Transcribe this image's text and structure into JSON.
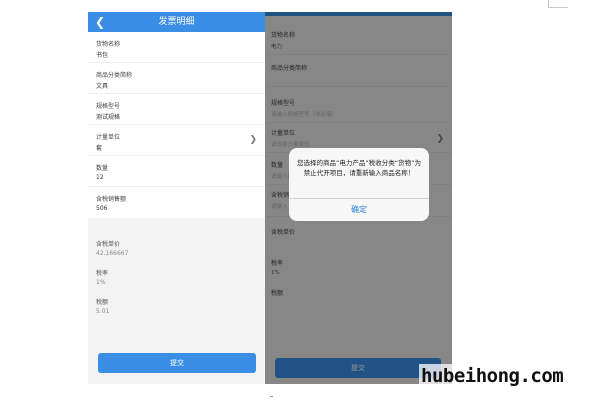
{
  "left_screen": {
    "title": "发票明细",
    "back_icon": "back-chevron-icon",
    "fields": [
      {
        "label": "货物名称",
        "value": "书包"
      },
      {
        "label": "商品分类简称",
        "value": "文具"
      },
      {
        "label": "规格型号",
        "value": "测试规格"
      },
      {
        "label": "计量单位",
        "value": "套"
      },
      {
        "label": "数量",
        "value": "12"
      },
      {
        "label": "含税销售额",
        "value": "506"
      }
    ],
    "readonly_fields": [
      {
        "label": "含税单价",
        "value": "42.166667"
      },
      {
        "label": "税率",
        "value": "1%"
      },
      {
        "label": "税额",
        "value": "5.01"
      }
    ],
    "submit_label": "提交"
  },
  "right_screen": {
    "goods_name_label": "货物名称",
    "goods_name_value": "电力",
    "category_label": "商品分类简称",
    "spec_label": "规格型号",
    "spec_placeholder": "请输入规格型号（非必填）",
    "unit_label": "计量单位",
    "unit_placeholder": "请选择计量单位",
    "qty_label": "数量",
    "qty_placeholder": "请输入数量（必填）",
    "amount_label": "含税销售",
    "amount_placeholder": "请输入",
    "unit_price_label": "含税单价",
    "tax_rate_label": "税率",
    "tax_rate_value": "1%",
    "tax_amount_label": "税额",
    "submit_label": "提交",
    "dialog": {
      "message": "您选择的商品“电力产品”税收分类“货物”为禁止代开项目，请重新输入商品名称！",
      "confirm_label": "确定"
    }
  },
  "watermark": "hubeihong.com",
  "colors": {
    "primary": "#3a8ee6",
    "dialog_button": "#2f7fd9"
  }
}
